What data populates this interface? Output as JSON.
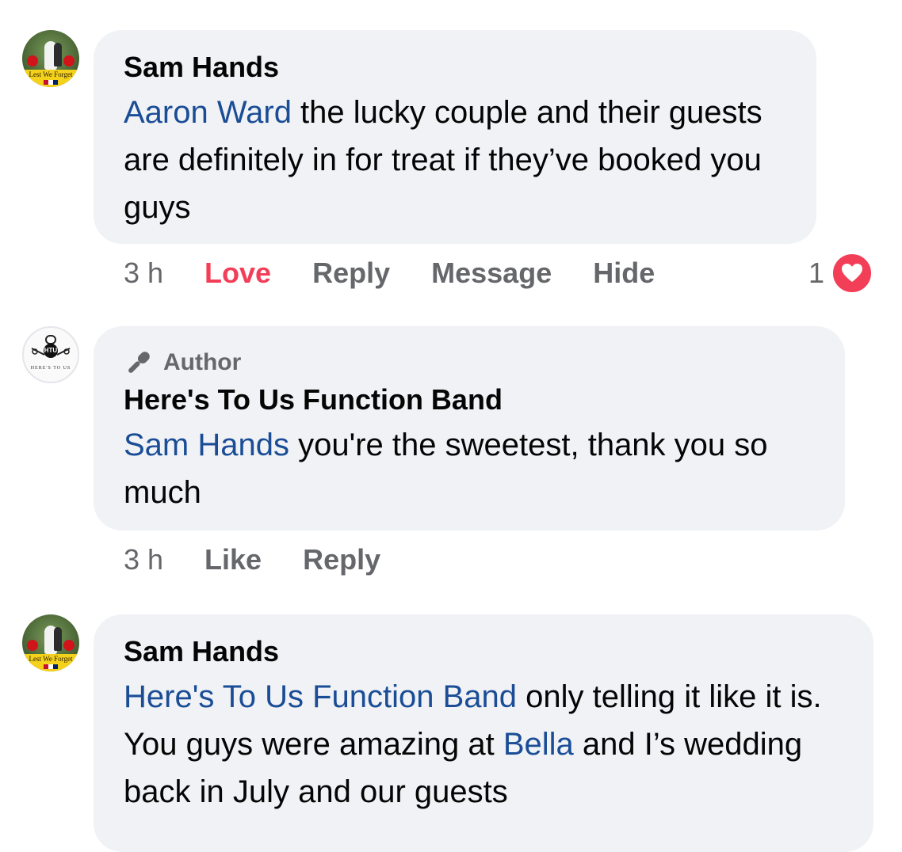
{
  "comments": [
    {
      "author": "Sam Hands",
      "avatar_text": "Lest We Forget",
      "mention": "Aaron Ward",
      "text": " the lucky couple and their guests are definitely in for treat if they’ve booked you guys",
      "time": "3 h",
      "actions": [
        "Love",
        "Reply",
        "Message",
        "Hide"
      ],
      "reaction_count": "1",
      "reaction_icon": "heart-icon",
      "reaction_color": "#f33e58"
    },
    {
      "badge": "Author",
      "badge_icon": "microphone-icon",
      "author": "Here's To Us Function Band",
      "avatar_text": "HTU",
      "avatar_caption": "HERE'S TO US",
      "mention": "Sam Hands",
      "text": " you're the sweetest, thank you so much",
      "time": "3 h",
      "actions": [
        "Like",
        "Reply"
      ]
    },
    {
      "author": "Sam Hands",
      "avatar_text": "Lest We Forget",
      "mention": "Here's To Us Function Band",
      "text_1": " only telling it like it is. You guys were amazing at ",
      "mention_2": "Bella",
      "text_2": " and I’s wedding back in July and our guests"
    }
  ],
  "colors": {
    "mention": "#1a4d96",
    "bubble": "#f0f2f5",
    "secondary_text": "#65676b",
    "love": "#f33e58"
  }
}
